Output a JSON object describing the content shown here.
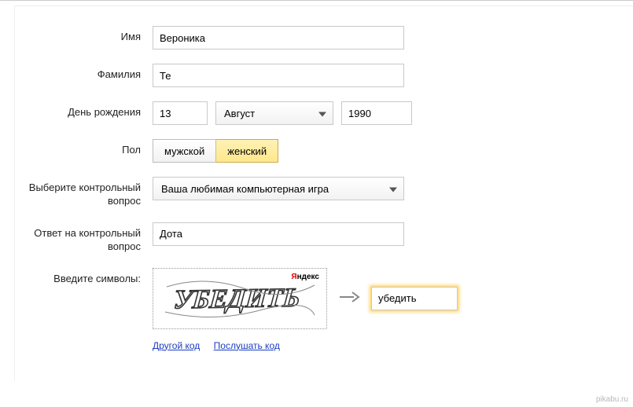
{
  "labels": {
    "first_name": "Имя",
    "last_name": "Фамилия",
    "birthday": "День рождения",
    "gender": "Пол",
    "choose_question": "Выберите контрольный вопрос",
    "answer": "Ответ на контрольный вопрос",
    "enter_symbols": "Введите символы:"
  },
  "values": {
    "first_name": "Вероника",
    "last_name": "Те",
    "day": "13",
    "month": "Август",
    "year": "1990",
    "question": "Ваша любимая компьютерная игра",
    "answer": "Дота",
    "captcha_input": "убедить"
  },
  "gender": {
    "male": "мужской",
    "female": "женский",
    "selected": "female"
  },
  "captcha": {
    "brand_y": "Я",
    "brand_rest": "ндекс",
    "word": "УБЕДИТЬ",
    "other_code": "Другой код",
    "listen_code": "Послушать код"
  },
  "watermark": "pikabu.ru"
}
